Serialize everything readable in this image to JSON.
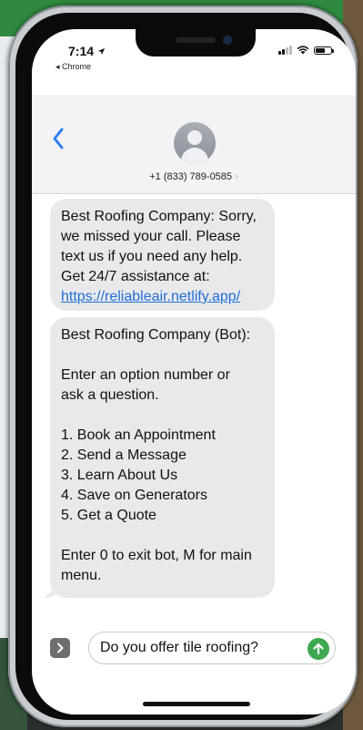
{
  "status": {
    "time": "7:14",
    "back_app": "◂ Chrome"
  },
  "header": {
    "back_icon": "chevron-left-icon",
    "contact_number": "+1 (833) 789-0585",
    "number_chevron": "›"
  },
  "messages": [
    {
      "sender": "received",
      "lines": [
        "Best Roofing Company: Sorry,",
        "we missed your call. Please",
        "text us if you need any help.",
        "Get 24/7 assistance at:"
      ],
      "link": "https://reliableair.netlify.app/"
    },
    {
      "sender": "received",
      "lines_top": [
        "Best Roofing Company (Bot):",
        "",
        "Enter an option number or",
        "ask a question.",
        ""
      ],
      "options": [
        "1. Book an Appointment",
        "2. Send a Message",
        "3. Learn About Us",
        "4. Save on Generators",
        "5. Get a Quote"
      ],
      "lines_bottom": [
        "",
        "Enter 0 to exit bot, M for main",
        "menu."
      ]
    }
  ],
  "composer": {
    "apps_icon": "chevron-right-icon",
    "input_value": "Do you offer tile roofing?",
    "send_icon": "arrow-up-icon"
  },
  "colors": {
    "bubble_received": "#e9e9eb",
    "link": "#1f6fd6",
    "ios_blue": "#2e7df6",
    "send_green": "#3ea84f"
  }
}
